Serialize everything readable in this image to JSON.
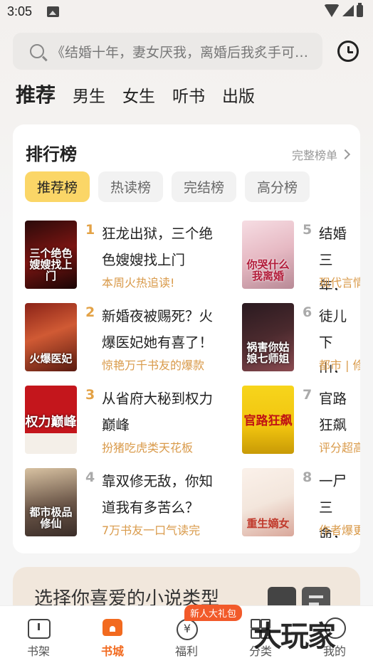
{
  "status": {
    "time": "3:05"
  },
  "search": {
    "placeholder": "《结婚十年，妻女厌我，离婚后我炙手可热》"
  },
  "tabs": [
    {
      "label": "推荐"
    },
    {
      "label": "男生"
    },
    {
      "label": "女生"
    },
    {
      "label": "听书"
    },
    {
      "label": "出版"
    }
  ],
  "ranking": {
    "title": "排行榜",
    "more": "完整榜单",
    "chips": [
      {
        "label": "推荐榜"
      },
      {
        "label": "热读榜"
      },
      {
        "label": "完结榜"
      },
      {
        "label": "高分榜"
      }
    ],
    "items": [
      {
        "rank": "1",
        "title": "狂龙出狱，三个绝色嫂嫂找上门",
        "sub": "本周火热追读!",
        "cover_text": "三个绝色嫂嫂找上门",
        "cover_color": "#7a1512"
      },
      {
        "rank": "2",
        "title": "新婚夜被赐死？火爆医妃她有喜了！",
        "sub": "惊艳万千书友的爆款",
        "cover_text": "火爆医妃",
        "cover_color": "#b6432c"
      },
      {
        "rank": "3",
        "title": "从省府大秘到权力巅峰",
        "sub": "扮猪吃虎类天花板",
        "cover_text": "权力巅峰",
        "cover_color": "#c4161c"
      },
      {
        "rank": "4",
        "title": "靠双修无敌，你知道我有多苦么？",
        "sub": "7万书友一口气读完",
        "cover_text": "都市极品修仙",
        "cover_color": "#6b5648"
      },
      {
        "rank": "5",
        "title": "结婚三年，我离婚",
        "sub": "现代言情",
        "cover_text": "你哭什么我离婚",
        "cover_color": "#e6b9c3"
      },
      {
        "rank": "6",
        "title": "徒儿下山，祸害你的姑娘",
        "sub": "都市 | 修仙",
        "cover_text": "祸害你姑娘七师姐",
        "cover_color": "#4b2a2e"
      },
      {
        "rank": "7",
        "title": "官路狂飙",
        "sub": "评分超高",
        "cover_text": "官路狂飙",
        "cover_color": "#f1c40f"
      },
      {
        "rank": "8",
        "title": "一尸三命，重生嫡女",
        "sub": "作者爆更",
        "cover_text": "重生嫡女",
        "cover_color": "#f3e6dc"
      }
    ]
  },
  "banner": {
    "title": "选择你喜爱的小说类型"
  },
  "nav": {
    "items": [
      {
        "label": "书架"
      },
      {
        "label": "书城"
      },
      {
        "label": "福利"
      },
      {
        "label": "分类"
      },
      {
        "label": "我的"
      }
    ],
    "badge": "新人大礼包"
  },
  "watermark": "大玩家",
  "colors": {
    "accent": "#f26a1f",
    "chip_active": "#fbd667",
    "sub_text": "#d99a4a"
  }
}
